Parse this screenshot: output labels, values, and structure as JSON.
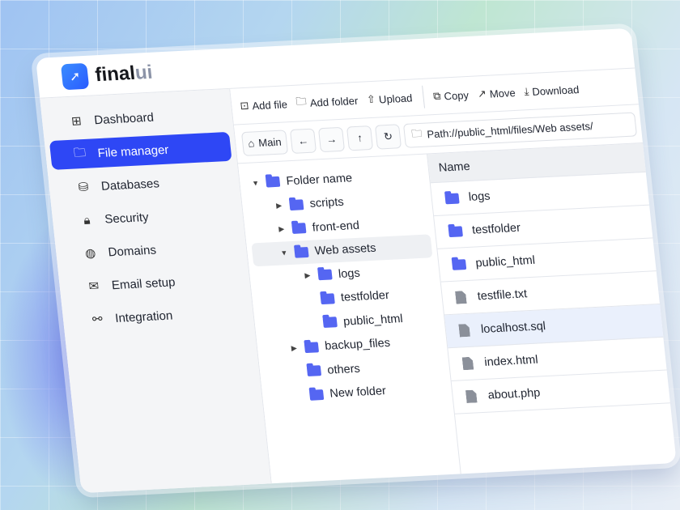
{
  "app": {
    "brand_main": "final",
    "brand_accent": "ui"
  },
  "sidebar": {
    "items": [
      {
        "label": "Dashboard",
        "icon": "grid-icon"
      },
      {
        "label": "File manager",
        "icon": "folder-icon",
        "active": true
      },
      {
        "label": "Databases",
        "icon": "database-icon"
      },
      {
        "label": "Security",
        "icon": "lock-icon"
      },
      {
        "label": "Domains",
        "icon": "globe-icon"
      },
      {
        "label": "Email setup",
        "icon": "mail-icon"
      },
      {
        "label": "Integration",
        "icon": "plug-icon"
      }
    ]
  },
  "toolbar": {
    "add_file": "Add file",
    "add_folder": "Add folder",
    "upload": "Upload",
    "copy": "Copy",
    "move": "Move",
    "download": "Download"
  },
  "nav": {
    "main": "Main",
    "path": "Path://public_html/files/Web assets/"
  },
  "tree": [
    {
      "label": "Folder name",
      "level": 0,
      "arrow": "down"
    },
    {
      "label": "scripts",
      "level": 1,
      "arrow": "right"
    },
    {
      "label": "front-end",
      "level": 1,
      "arrow": "right"
    },
    {
      "label": "Web assets",
      "level": 1,
      "arrow": "down",
      "selected": true
    },
    {
      "label": "logs",
      "level": 2,
      "arrow": "right"
    },
    {
      "label": "testfolder",
      "level": 2,
      "arrow": ""
    },
    {
      "label": "public_html",
      "level": 2,
      "arrow": ""
    },
    {
      "label": "backup_files",
      "level": 1,
      "arrow": "right"
    },
    {
      "label": "others",
      "level": 1,
      "arrow": ""
    },
    {
      "label": "New folder",
      "level": 1,
      "arrow": ""
    }
  ],
  "list": {
    "header": "Name",
    "items": [
      {
        "name": "logs",
        "type": "folder"
      },
      {
        "name": "testfolder",
        "type": "folder"
      },
      {
        "name": "public_html",
        "type": "folder"
      },
      {
        "name": "testfile.txt",
        "type": "file"
      },
      {
        "name": "localhost.sql",
        "type": "file",
        "selected": true
      },
      {
        "name": "index.html",
        "type": "file"
      },
      {
        "name": "about.php",
        "type": "file"
      }
    ]
  }
}
